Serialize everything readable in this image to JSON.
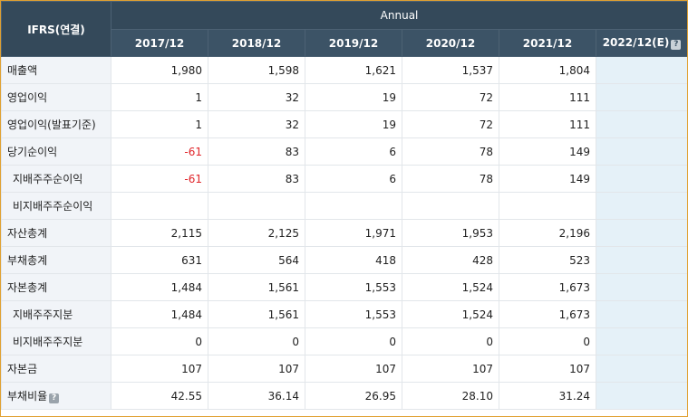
{
  "header": {
    "corner_label": "IFRS(연결)",
    "group_label": "Annual",
    "periods": [
      "2017/12",
      "2018/12",
      "2019/12",
      "2020/12",
      "2021/12",
      "2022/12(E)"
    ]
  },
  "rows": [
    {
      "label": "매출액",
      "values": [
        "1,980",
        "1,598",
        "1,621",
        "1,537",
        "1,804"
      ]
    },
    {
      "label": "영업이익",
      "values": [
        "1",
        "32",
        "19",
        "72",
        "111"
      ]
    },
    {
      "label": "영업이익(발표기준)",
      "values": [
        "1",
        "32",
        "19",
        "72",
        "111"
      ]
    },
    {
      "label": "당기순이익",
      "values": [
        "-61",
        "83",
        "6",
        "78",
        "149"
      ]
    },
    {
      "label": "지배주주순이익",
      "values": [
        "-61",
        "83",
        "6",
        "78",
        "149"
      ]
    },
    {
      "label": "비지배주주순이익",
      "values": [
        "",
        "",
        "",
        "",
        ""
      ]
    },
    {
      "label": "자산총계",
      "values": [
        "2,115",
        "2,125",
        "1,971",
        "1,953",
        "2,196"
      ]
    },
    {
      "label": "부채총계",
      "values": [
        "631",
        "564",
        "418",
        "428",
        "523"
      ]
    },
    {
      "label": "자본총계",
      "values": [
        "1,484",
        "1,561",
        "1,553",
        "1,524",
        "1,673"
      ]
    },
    {
      "label": "지배주주지분",
      "values": [
        "1,484",
        "1,561",
        "1,553",
        "1,524",
        "1,673"
      ]
    },
    {
      "label": "비지배주주지분",
      "values": [
        "0",
        "0",
        "0",
        "0",
        "0"
      ]
    },
    {
      "label": "자본금",
      "values": [
        "107",
        "107",
        "107",
        "107",
        "107"
      ]
    },
    {
      "label": "부채비율",
      "values": [
        "42.55",
        "36.14",
        "26.95",
        "28.10",
        "31.24"
      ]
    }
  ],
  "help_icon_glyph": "?",
  "colors": {
    "header_bg": "#34495a",
    "label_bg": "#f1f4f8",
    "estimate_bg": "#e5f1f8",
    "negative": "#e0262b",
    "frame_border": "#e0a030"
  }
}
